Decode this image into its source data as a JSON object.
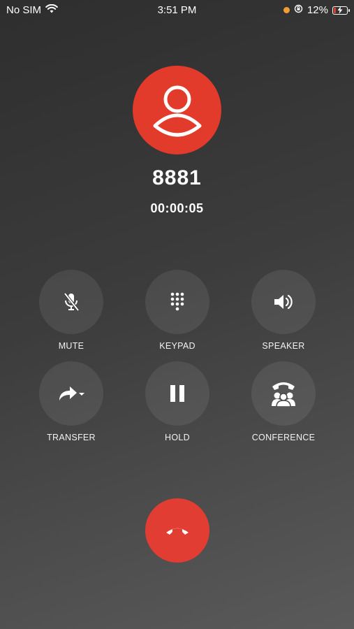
{
  "status_bar": {
    "carrier": "No SIM",
    "time": "3:51 PM",
    "battery_percent": "12%",
    "battery_level": 0.12,
    "icons": [
      "wifi-icon",
      "orange-dot-indicator",
      "orientation-lock-icon",
      "battery-charging-icon"
    ]
  },
  "call": {
    "caller": "8881",
    "duration": "00:00:05",
    "avatar_color": "#e23a2b"
  },
  "controls": {
    "mute": {
      "label": "MUTE",
      "icon": "mic-off-icon"
    },
    "keypad": {
      "label": "KEYPAD",
      "icon": "keypad-icon"
    },
    "speaker": {
      "label": "SPEAKER",
      "icon": "speaker-icon"
    },
    "transfer": {
      "label": "TRANSFER",
      "icon": "transfer-icon"
    },
    "hold": {
      "label": "HOLD",
      "icon": "pause-icon"
    },
    "conference": {
      "label": "CONFERENCE",
      "icon": "conference-icon"
    }
  },
  "end_call": {
    "icon": "hang-up-icon",
    "color": "#e23d32"
  }
}
